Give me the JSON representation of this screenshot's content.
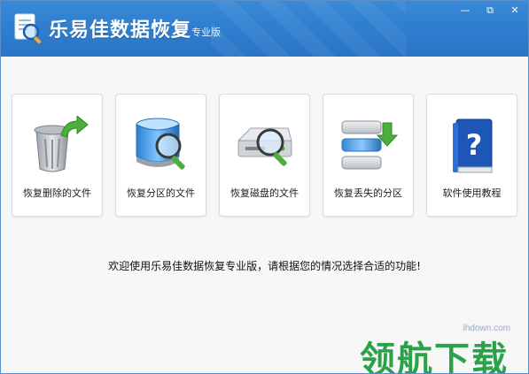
{
  "app": {
    "title": "乐易佳数据恢复",
    "edition": "专业版",
    "window_controls": {
      "minimize": "—",
      "restore": "⧉",
      "close": "✕"
    }
  },
  "cards": [
    {
      "label": "恢复删除的文件",
      "icon": "trash-recycle-icon"
    },
    {
      "label": "恢复分区的文件",
      "icon": "partition-search-icon"
    },
    {
      "label": "恢复磁盘的文件",
      "icon": "disk-search-icon"
    },
    {
      "label": "恢复丢失的分区",
      "icon": "lost-partition-icon"
    },
    {
      "label": "软件使用教程",
      "icon": "help-book-icon"
    }
  ],
  "welcome_text": "欢迎使用乐易佳数据恢复专业版，请根据您的情况选择合适的功能!",
  "watermark": {
    "url": "lhdown.com",
    "text": "领航下载"
  },
  "colors": {
    "titlebar": "#2f7fd0",
    "accent_green": "#4caf3c",
    "watermark_green": "#2aa24a"
  }
}
